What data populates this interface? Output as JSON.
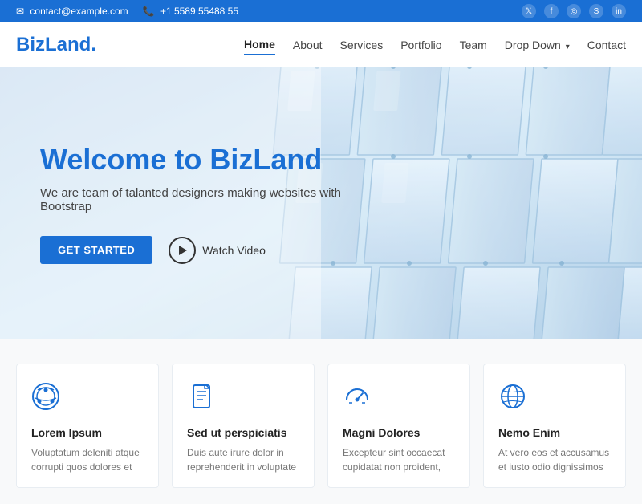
{
  "topbar": {
    "email": "contact@example.com",
    "phone": "+1 5589 55488 55",
    "social": [
      "twitter",
      "facebook",
      "instagram",
      "skype",
      "linkedin"
    ]
  },
  "brand": {
    "name": "BizLand",
    "dot": "."
  },
  "nav": {
    "links": [
      {
        "label": "Home",
        "active": true
      },
      {
        "label": "About",
        "active": false
      },
      {
        "label": "Services",
        "active": false
      },
      {
        "label": "Portfolio",
        "active": false
      },
      {
        "label": "Team",
        "active": false
      },
      {
        "label": "Drop Down",
        "active": false,
        "has_dropdown": true
      },
      {
        "label": "Contact",
        "active": false
      }
    ]
  },
  "hero": {
    "title_part1": "Welcome to ",
    "title_highlight": "BizLand",
    "subtitle": "We are team of talanted designers making websites with Bootstrap",
    "btn_primary": "GET STARTED",
    "btn_video": "Watch Video"
  },
  "cards": [
    {
      "icon": "dribbble",
      "title": "Lorem Ipsum",
      "text": "Voluptatum deleniti atque corrupti quos dolores et"
    },
    {
      "icon": "file",
      "title": "Sed ut perspiciatis",
      "text": "Duis aute irure dolor in reprehenderit in voluptate"
    },
    {
      "icon": "speedometer",
      "title": "Magni Dolores",
      "text": "Excepteur sint occaecat cupidatat non proident,"
    },
    {
      "icon": "globe",
      "title": "Nemo Enim",
      "text": "At vero eos et accusamus et iusto odio dignissimos"
    }
  ],
  "colors": {
    "brand_blue": "#1a6fd4",
    "text_dark": "#1a1a2e",
    "text_gray": "#777"
  }
}
